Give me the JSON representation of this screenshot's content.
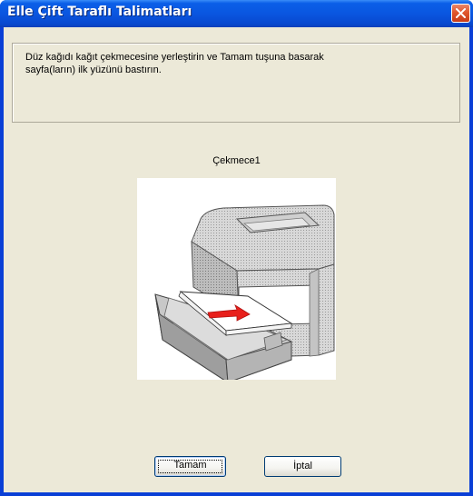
{
  "window": {
    "title": "Elle Çift Taraflı Talimatları"
  },
  "message": {
    "line1": "Düz kağıdı kağıt çekmecesine yerleştirin ve Tamam tuşuna basarak",
    "line2": "sayfa(ların) ilk yüzünü bastırın."
  },
  "tray": {
    "label": "Çekmece1"
  },
  "buttons": {
    "ok_label": "Tamam",
    "cancel_label": "İptal"
  },
  "colors": {
    "titlebar": "#0a56e0",
    "client": "#ece9d8",
    "close": "#e0572d",
    "arrow": "#e8201c"
  },
  "icons": {
    "close": "close-icon",
    "illustration": "printer-paper-tray-illustration"
  }
}
